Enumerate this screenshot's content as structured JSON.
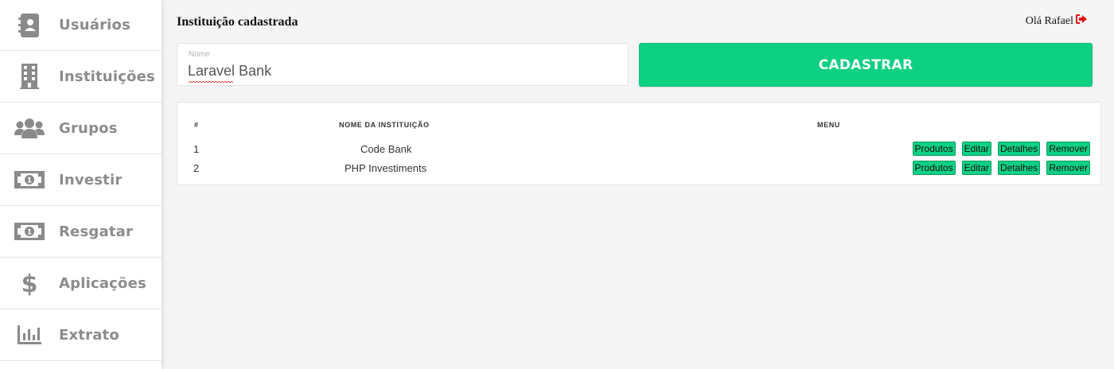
{
  "sidebar": {
    "items": [
      {
        "label": "Usuários",
        "icon": "address-book-icon"
      },
      {
        "label": "Instituições",
        "icon": "building-icon"
      },
      {
        "label": "Grupos",
        "icon": "users-icon"
      },
      {
        "label": "Investir",
        "icon": "money-bill-icon"
      },
      {
        "label": "Resgatar",
        "icon": "money-bill-icon"
      },
      {
        "label": "Aplicações",
        "icon": "dollar-icon"
      },
      {
        "label": "Extrato",
        "icon": "bar-chart-icon"
      }
    ]
  },
  "header": {
    "title": "Instituição cadastrada",
    "greeting": "Olá Rafael",
    "logout_icon": "sign-out-icon"
  },
  "form": {
    "name_label": "Nome",
    "name_value": "Laravel Bank",
    "submit_label": "CADASTRAR"
  },
  "table": {
    "columns": [
      "#",
      "NOME DA INSTITUIÇÃO",
      "MENU"
    ],
    "rows": [
      {
        "id": "1",
        "name": "Code Bank"
      },
      {
        "id": "2",
        "name": "PHP Investiments"
      }
    ],
    "actions": [
      "Produtos",
      "Editar",
      "Detalhes",
      "Remover"
    ]
  },
  "colors": {
    "accent": "#0dd082",
    "sidebar_text": "#8c8c8c",
    "logout_icon": "#e01010"
  }
}
